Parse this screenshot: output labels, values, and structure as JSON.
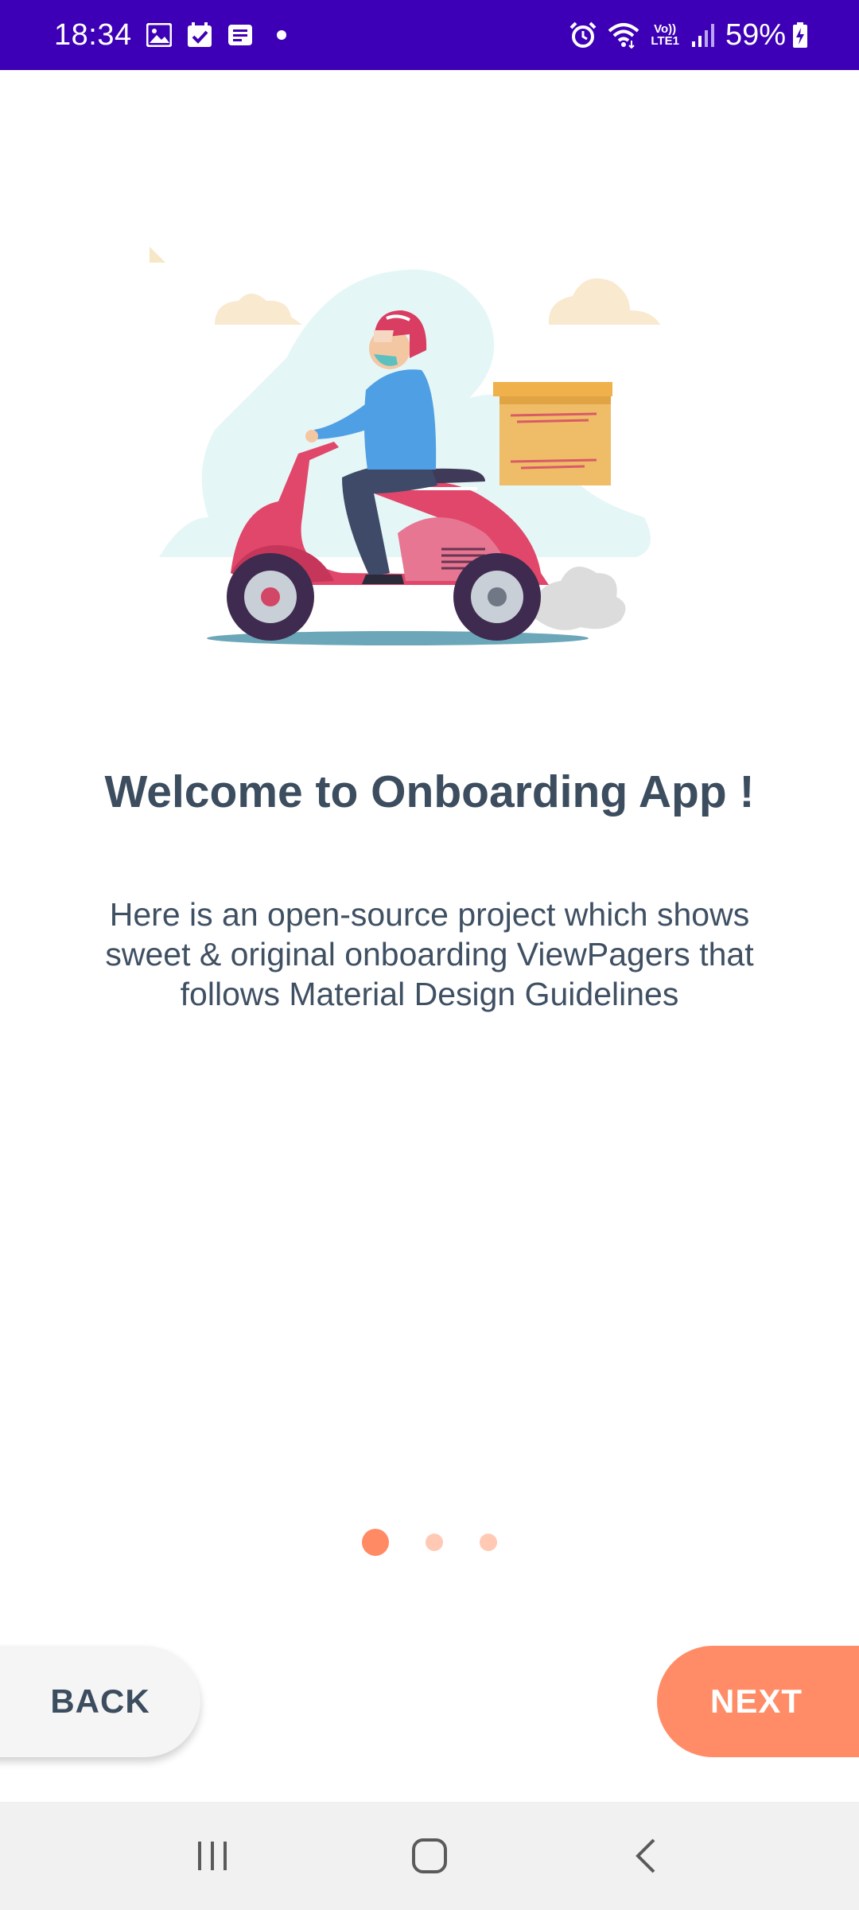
{
  "status_bar": {
    "time": "18:34",
    "battery": "59%",
    "network": "LTE1",
    "volte": "Vo))",
    "left_icons": [
      "image-icon",
      "calendar-check-icon",
      "message-icon",
      "dot-icon"
    ],
    "right_icons": [
      "alarm-icon",
      "wifi-icon",
      "volte-lte-icon",
      "signal-icon",
      "battery-charging-icon"
    ],
    "background": "#3d00b6"
  },
  "onboarding": {
    "illustration": "delivery-scooter-illustration",
    "title": "Welcome to Onboarding App !",
    "description": "Here is an open-source project which shows sweet & original onboarding ViewPagers that follows Material Design Guidelines",
    "page_index": 1,
    "page_count": 3,
    "accent": "#ff8c66",
    "accent_light": "#ffc9b4"
  },
  "buttons": {
    "back_label": "BACK",
    "next_label": "NEXT"
  },
  "nav_bar": {
    "items": [
      "recent-apps-icon",
      "home-icon",
      "back-icon"
    ]
  }
}
